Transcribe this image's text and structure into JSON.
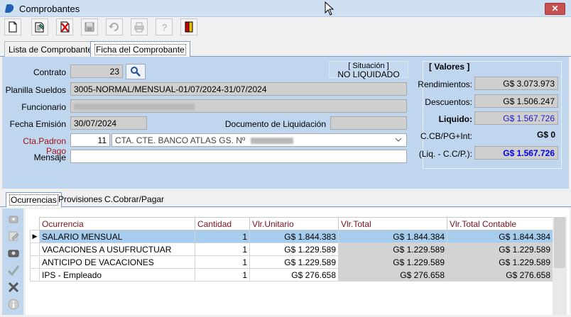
{
  "window": {
    "title": "Comprobantes",
    "close_glyph": "✕"
  },
  "toolbar": {
    "buttons": [
      {
        "name": "new-document-icon",
        "glyph": "new"
      },
      {
        "name": "edit-document-icon",
        "glyph": "edit"
      },
      {
        "name": "delete-document-icon",
        "glyph": "delete"
      },
      {
        "name": "save-icon",
        "glyph": "save"
      },
      {
        "name": "undo-icon",
        "glyph": "undo"
      },
      {
        "name": "print-icon",
        "glyph": "print"
      },
      {
        "name": "help-icon",
        "glyph": "?"
      },
      {
        "name": "exit-door-icon",
        "glyph": "exit"
      }
    ]
  },
  "tabs_top": {
    "lista": "Lista de Comprobantes",
    "ficha": "Ficha del Comprobante"
  },
  "form": {
    "contrato_label": "Contrato",
    "contrato_value": "23",
    "planilla_label": "Planilla Sueldos",
    "planilla_value": "3005-NORMAL/MENSUAL-01/07/2024-31/07/2024",
    "funcionario_label": "Funcionario",
    "fecha_label": "Fecha Emisión",
    "fecha_value": "30/07/2024",
    "documento_label": "Documento de Liquidación",
    "cta_label": "Cta.Padron Pago",
    "cta_code": "11",
    "cta_value": "CTA. CTE. BANCO ATLAS GS. Nº",
    "mensaje_label": "Mensaje",
    "situacion_title": "[ Situación ]",
    "situacion_value": "NO LIQUIDADO"
  },
  "valores": {
    "title": "[ Valores ]",
    "rendimientos_label": "Rendimientos:",
    "rendimientos_value": "G$ 3.073.973",
    "descuentos_label": "Descuentos:",
    "descuentos_value": "G$ 1.506.247",
    "liquido_label": "Liquido:",
    "liquido_value": "G$ 1.567.726",
    "cbpg_label": "C.CB/PG+Int:",
    "cbpg_value": "G$ 0",
    "liq_label": "(Liq. - C.C/P.):",
    "liq_value": "G$ 1.567.726",
    "liquido_color": "#1a1acc",
    "liq_color": "#0000ee"
  },
  "tabs_bottom": {
    "ocurrencias": "Ocurrencias",
    "provisiones": "Provisiones",
    "ccobrar": "C.Cobrar/Pagar"
  },
  "grid": {
    "headers": {
      "ocurrencia": "Ocurrencia",
      "cantidad": "Cantidad",
      "unitario": "Vlr.Unitario",
      "total": "Vlr.Total",
      "contable": "Vlr.Total Contable"
    },
    "rows": [
      {
        "ocurrencia": "SALARIO MENSUAL",
        "cantidad": "1",
        "unitario": "G$ 1.844.383",
        "total": "G$ 1.844.384",
        "contable": "G$ 1.844.384"
      },
      {
        "ocurrencia": "VACACIONES A USUFRUCTUAR",
        "cantidad": "1",
        "unitario": "G$ 1.229.589",
        "total": "G$ 1.229.589",
        "contable": "G$ 1.229.589"
      },
      {
        "ocurrencia": "ANTICIPO DE VACACIONES",
        "cantidad": "1",
        "unitario": "G$ 1.229.589",
        "total": "G$ 1.229.589",
        "contable": "G$ 1.229.589"
      },
      {
        "ocurrencia": "IPS - Empleado",
        "cantidad": "1",
        "unitario": "G$ 276.658",
        "total": "G$ 276.658",
        "contable": "G$ 276.658"
      }
    ],
    "selected_indicator": "▶"
  },
  "sidebar": {
    "buttons": [
      "add-record-icon",
      "edit-record-icon",
      "view-record-icon",
      "confirm-check-icon",
      "cancel-x-icon",
      "info-icon"
    ]
  },
  "colors": {
    "panel_bg": "#bfd6ee",
    "label_red": "#a31515",
    "selected_row": "#a6cdee"
  }
}
